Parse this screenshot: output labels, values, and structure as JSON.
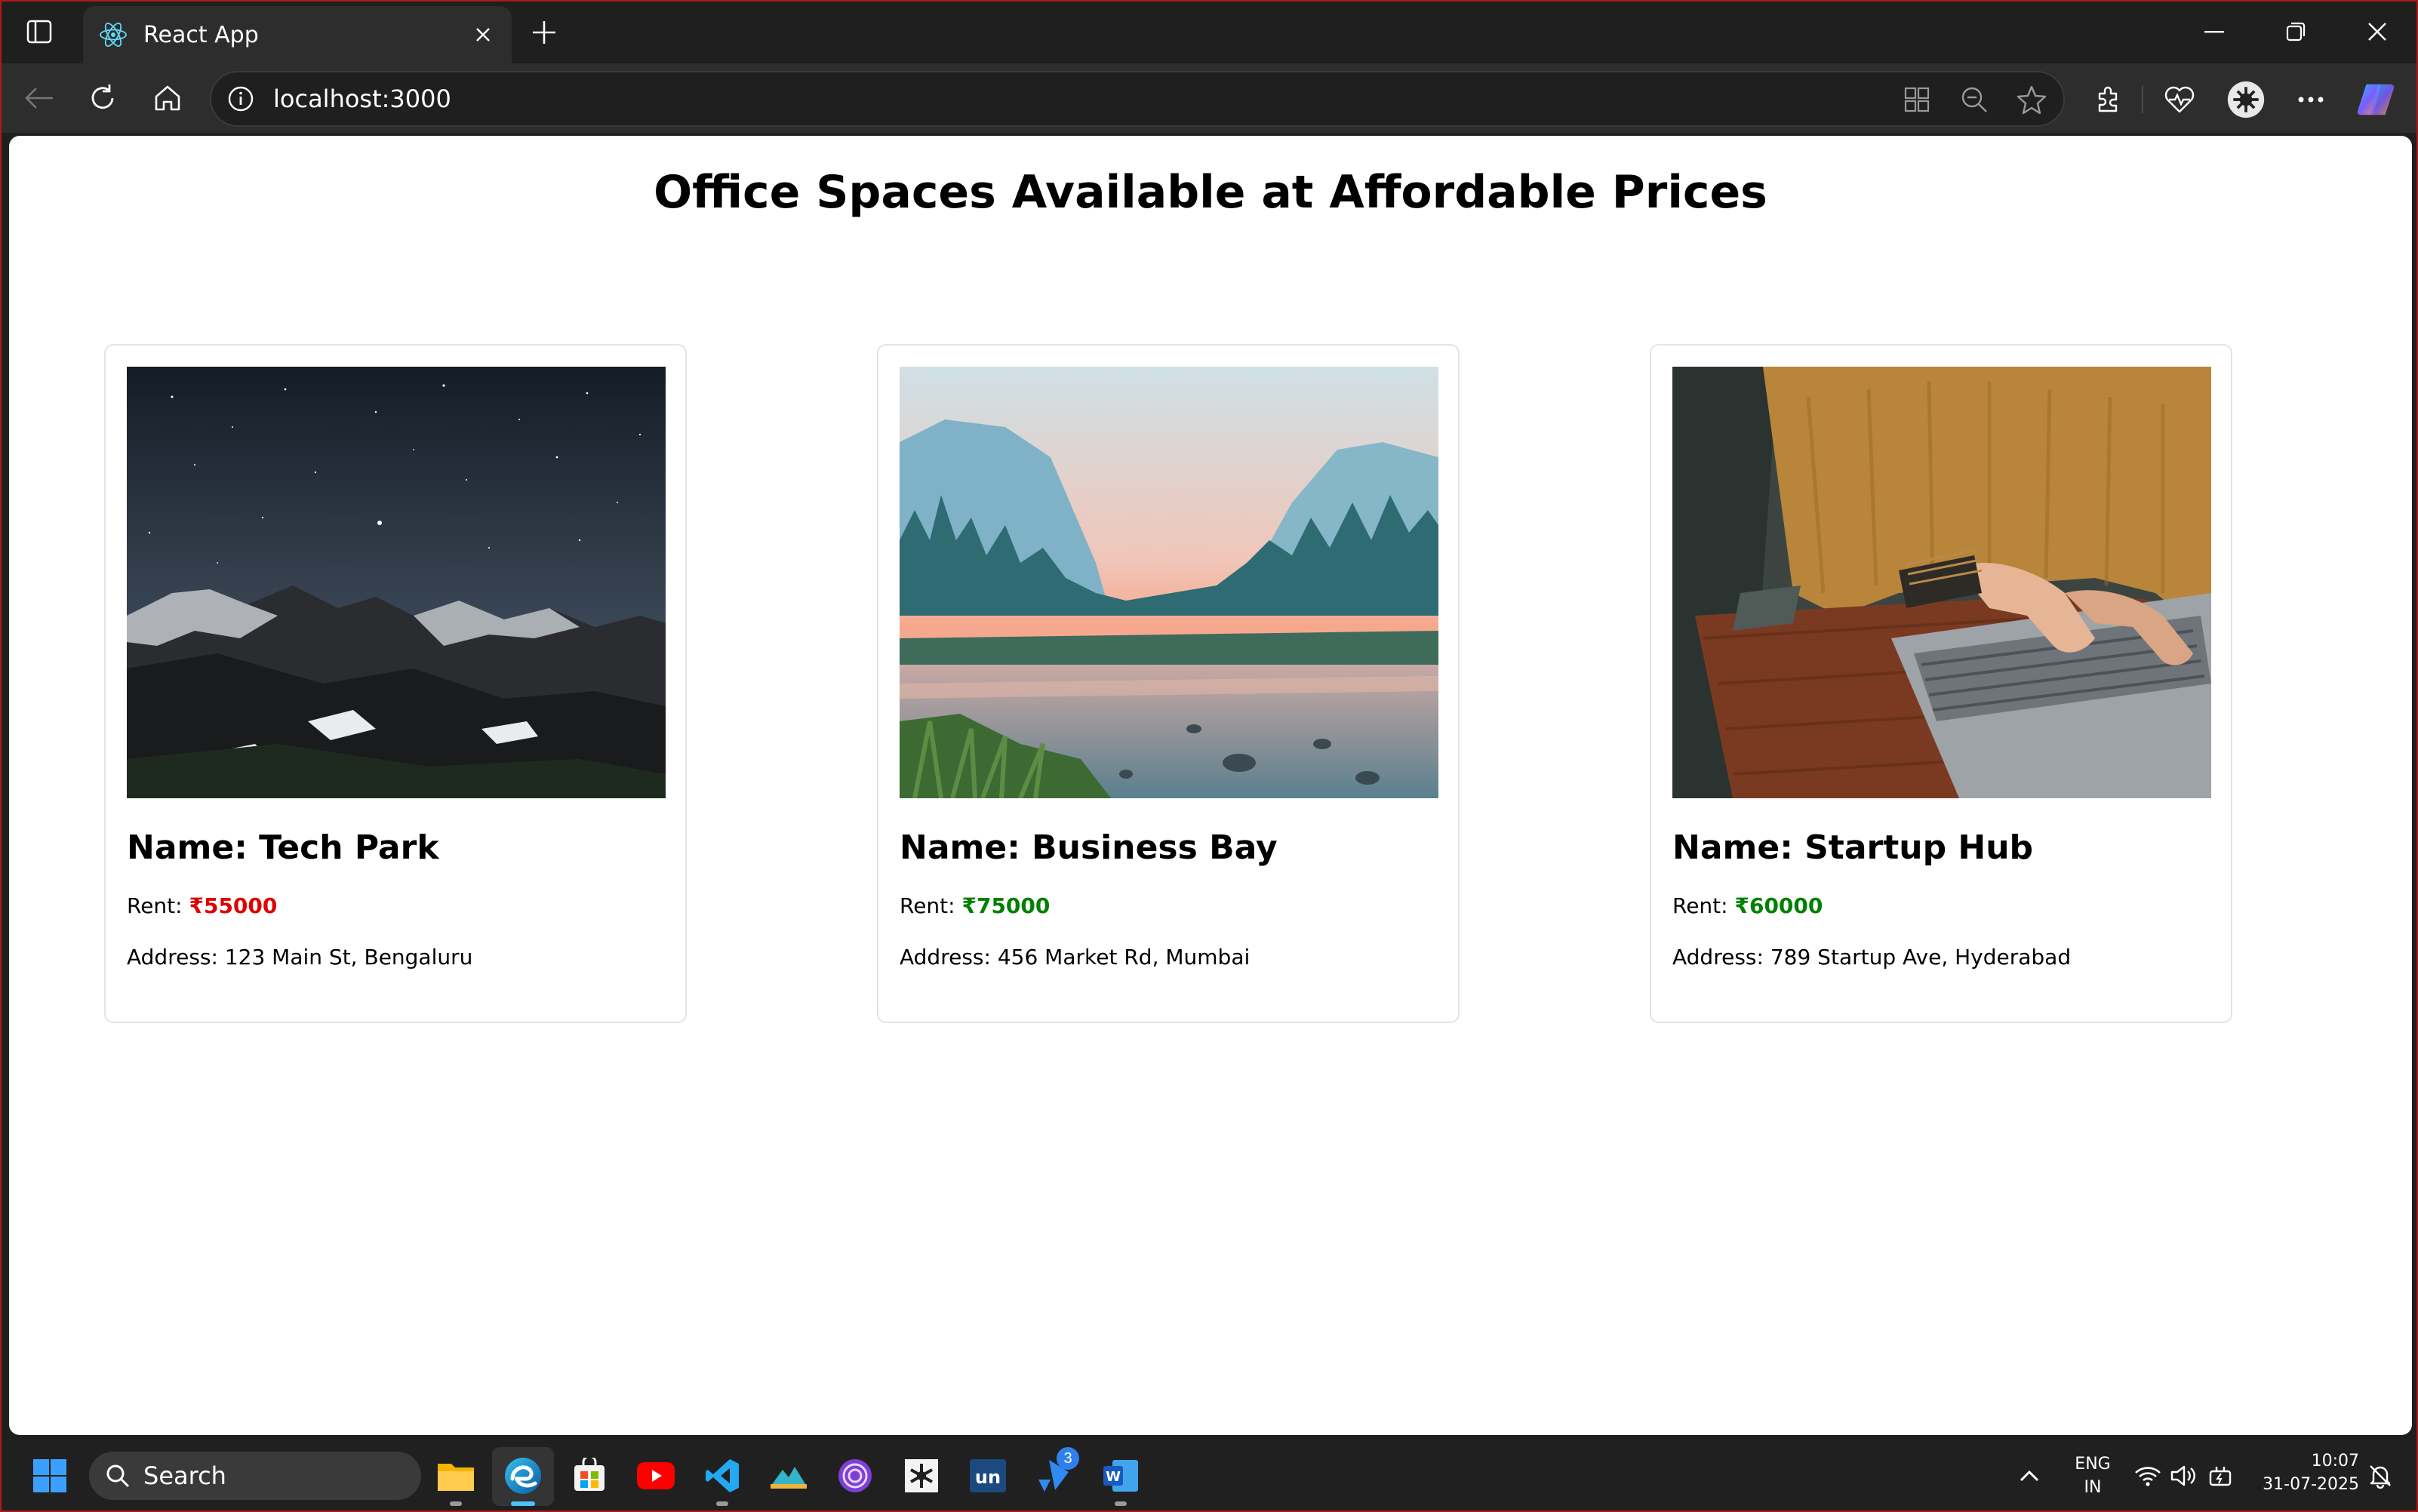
{
  "browser": {
    "tab_title": "React App",
    "url": "localhost:3000",
    "icons": [
      "sidebar-icon",
      "react-favicon",
      "close-icon",
      "plus-icon",
      "minimize-icon",
      "restore-icon",
      "close-window-icon",
      "back-icon",
      "refresh-icon",
      "home-icon",
      "info-icon",
      "apps-icon",
      "zoom-out-icon",
      "star-icon",
      "extensions-icon",
      "health-icon",
      "profile-icon",
      "more-icon",
      "copilot-icon"
    ]
  },
  "page": {
    "title": "Office Spaces Available at Affordable Prices",
    "rent_label": "Rent: ",
    "offices": [
      {
        "name": "Name: Tech Park",
        "rent": "₹55000",
        "rent_color": "#e00000",
        "address": "Address: 123 Main St, Bengaluru",
        "image": "starry-mountains"
      },
      {
        "name": "Name: Business Bay",
        "rent": "₹75000",
        "rent_color": "#008000",
        "address": "Address: 456 Market Rd, Mumbai",
        "image": "forest-river-valley"
      },
      {
        "name": "Name: Startup Hub",
        "rent": "₹60000",
        "rent_color": "#008000",
        "address": "Address: 789 Startup Ave, Hyderabad",
        "image": "person-typing-laptop"
      }
    ]
  },
  "taskbar": {
    "search_label": "Search",
    "language_line1": "ENG",
    "language_line2": "IN",
    "time": "10:07",
    "date": "31-07-2025",
    "badge_count": "3"
  }
}
